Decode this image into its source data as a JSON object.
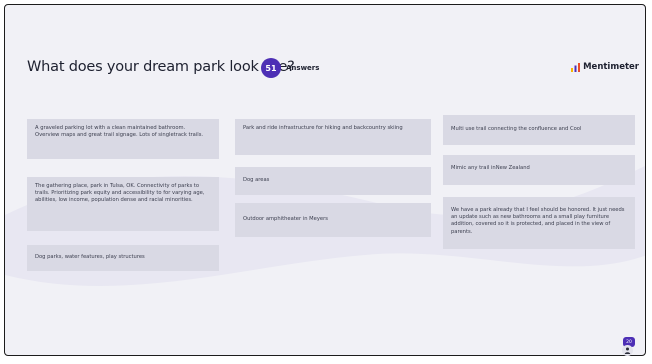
{
  "question": {
    "title": "What does your dream park look like?",
    "answer_count": "51",
    "answer_label": "Answers"
  },
  "brand": {
    "name": "Mentimeter",
    "icon": "bar-chart-icon",
    "colors": [
      "#f7b500",
      "#4d2fb5",
      "#e94d2a"
    ]
  },
  "responses": [
    {
      "text": "A graveled parking lot with a clean maintained bathroom. Overview maps and great trail signage. Lots of singletrack trails."
    },
    {
      "text": "The gathering place, park in Tulsa, OK. Connectivity of parks to trails. Prioritizing park equity and accessibility to for varying age, abilities, low income, population dense and racial minorities."
    },
    {
      "text": "Dog parks, water features, play structures"
    },
    {
      "text": "Park and ride infrastructure for hiking and backcountry skiing"
    },
    {
      "text": "Dog areas"
    },
    {
      "text": "Outdoor amphitheater in Meyers"
    },
    {
      "text": "Multi use trail connecting the confluence and Cool"
    },
    {
      "text": "Mimic any trail inNew Zealand"
    },
    {
      "text": "We have a park already that I feel should be honored. It just needs an update such as new bathrooms and a small play furniture addition, covered so it is protected, and placed in the view of parents."
    }
  ],
  "participants": {
    "count": "20",
    "icon": "person-icon"
  },
  "colors": {
    "accent": "#4d2fb5",
    "card": "#d9d9e4",
    "background": "#f1f1f6"
  }
}
